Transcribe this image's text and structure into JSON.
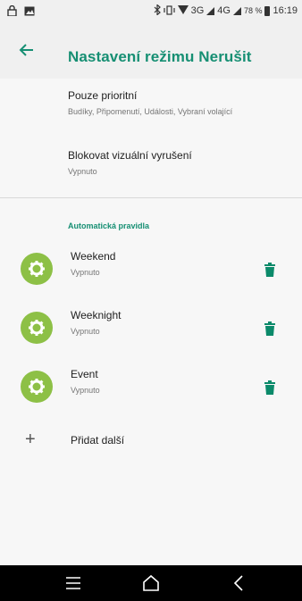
{
  "status_bar": {
    "battery_percent": "78 %",
    "time": "16:19",
    "network_3g": "3G",
    "network_4g": "4G"
  },
  "app_bar": {
    "title": "Nastavení režimu Nerušit"
  },
  "settings": [
    {
      "title": "Pouze prioritní",
      "subtitle": "Budíky, Připomenutí, Události, Vybraní volající"
    },
    {
      "title": "Blokovat vizuální vyrušení",
      "subtitle": "Vypnuto"
    }
  ],
  "automatic_rules": {
    "header": "Automatická pravidla",
    "rules": [
      {
        "title": "Weekend",
        "subtitle": "Vypnuto"
      },
      {
        "title": "Weeknight",
        "subtitle": "Vypnuto"
      },
      {
        "title": "Event",
        "subtitle": "Vypnuto"
      }
    ],
    "add_label": "Přidat další"
  },
  "colors": {
    "accent": "#168f73",
    "rule_icon_bg": "#8dc046",
    "trash": "#0b8a6a"
  }
}
